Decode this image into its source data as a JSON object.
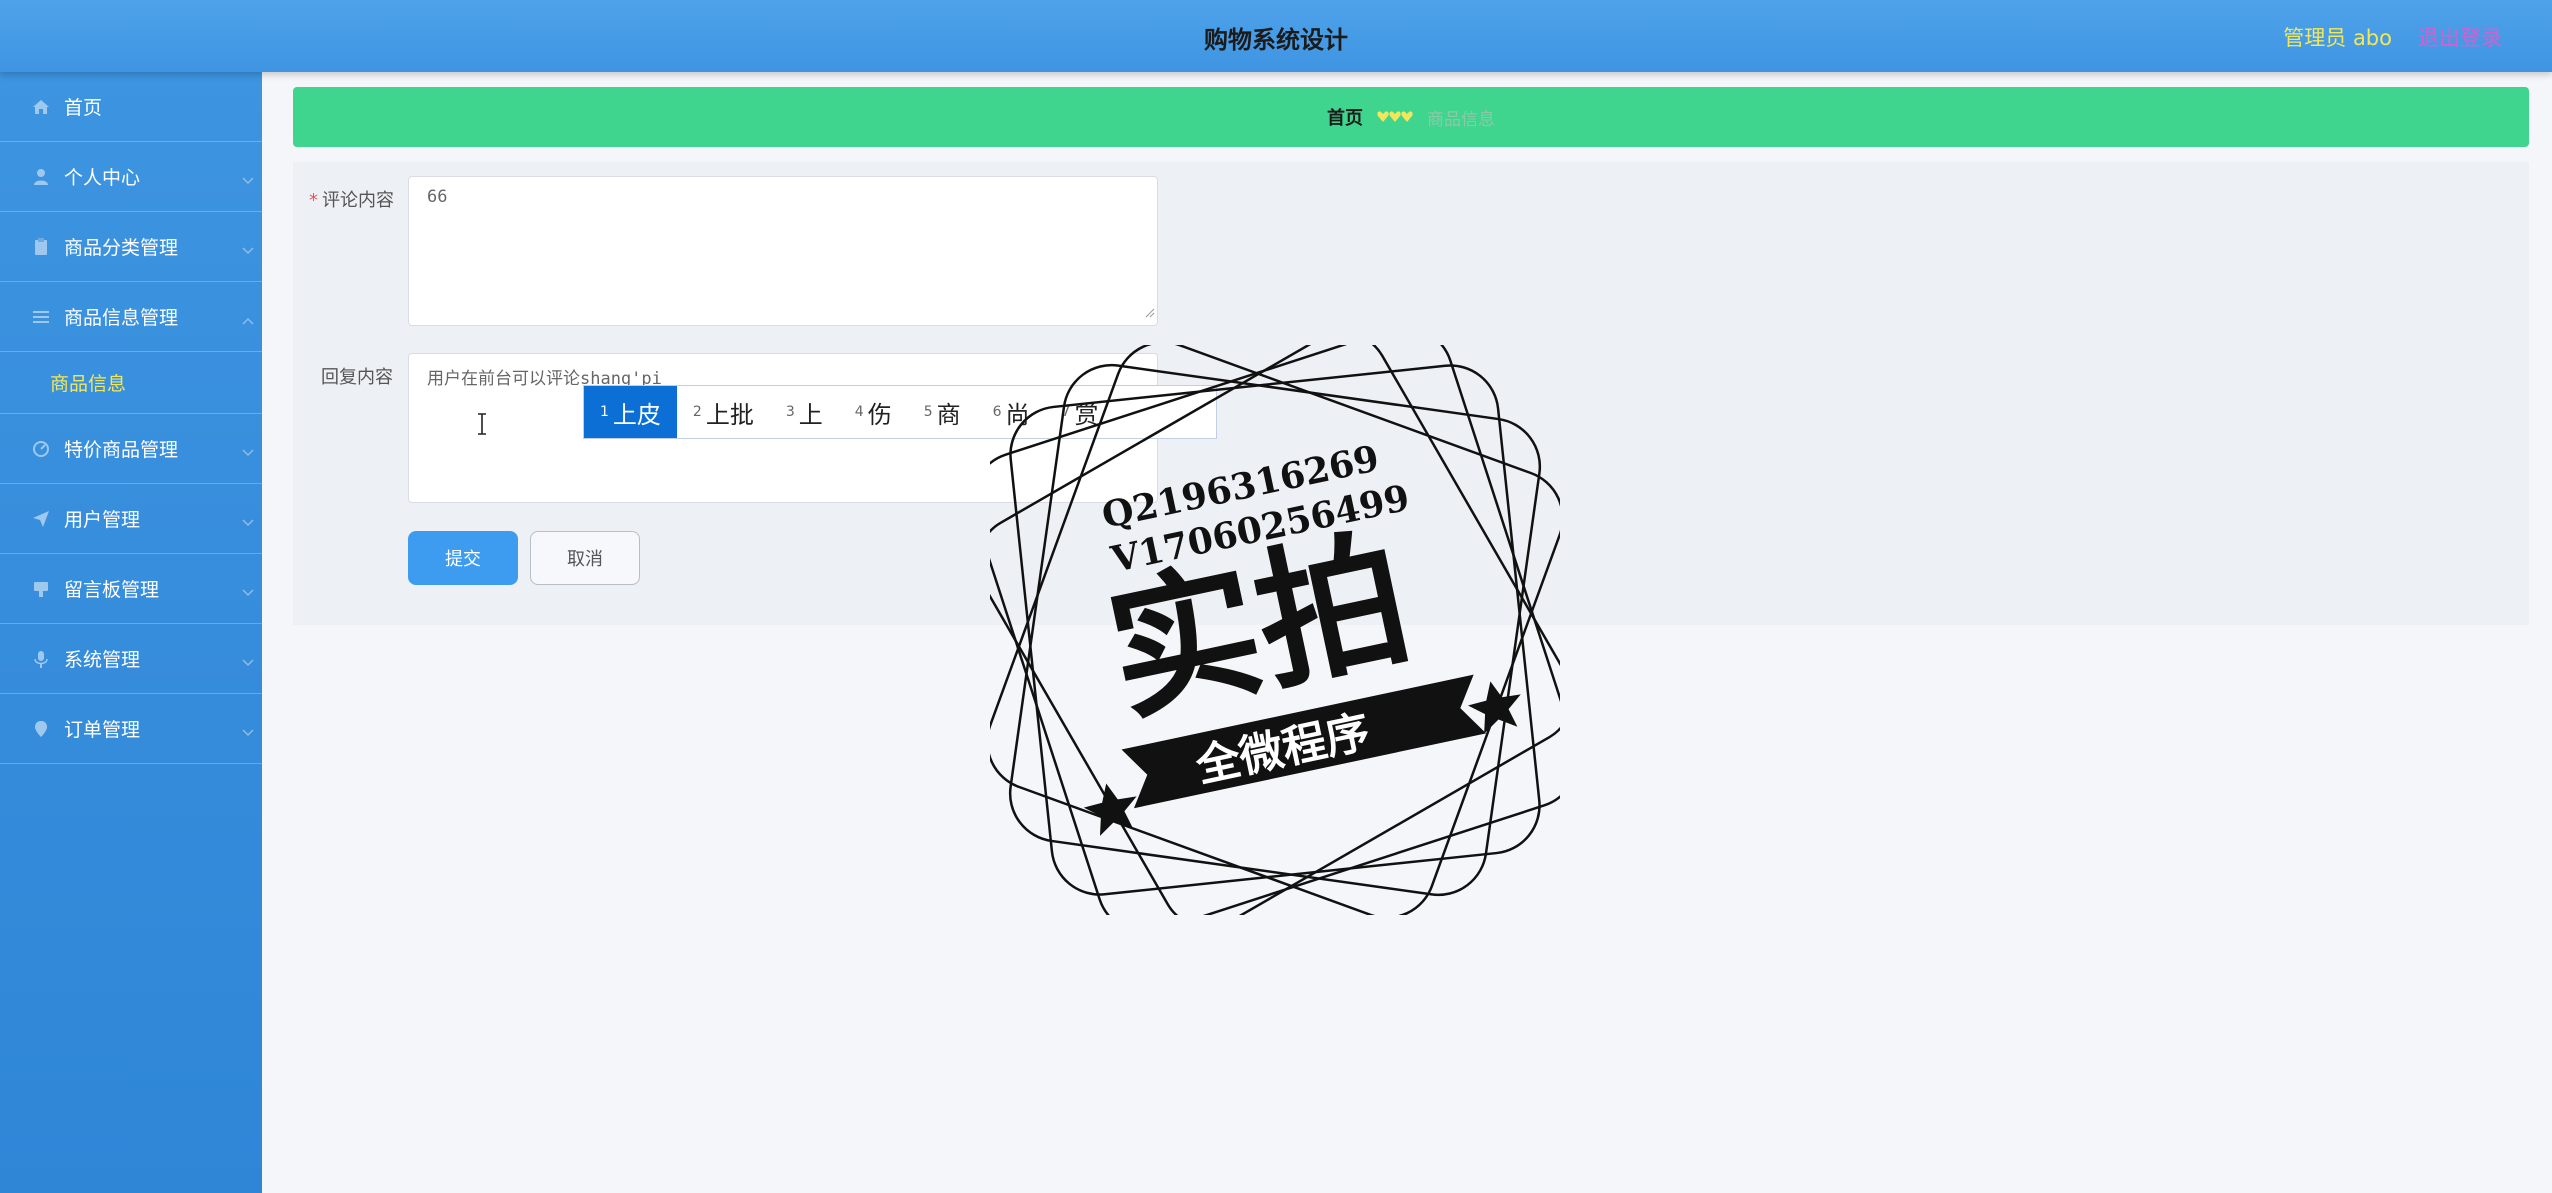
{
  "header": {
    "title": "购物系统设计",
    "user": "管理员 abo",
    "logout": "退出登录"
  },
  "sidebar": {
    "items": [
      {
        "label": "首页",
        "icon": "home-icon",
        "chevron": false
      },
      {
        "label": "个人中心",
        "icon": "user-icon",
        "chevron": true
      },
      {
        "label": "商品分类管理",
        "icon": "category-icon",
        "chevron": true
      },
      {
        "label": "商品信息管理",
        "icon": "list-icon",
        "chevron": true,
        "expanded": true,
        "children": [
          {
            "label": "商品信息"
          }
        ]
      },
      {
        "label": "特价商品管理",
        "icon": "dashboard-icon",
        "chevron": true
      },
      {
        "label": "用户管理",
        "icon": "send-icon",
        "chevron": true
      },
      {
        "label": "留言板管理",
        "icon": "message-board-icon",
        "chevron": true
      },
      {
        "label": "系统管理",
        "icon": "microphone-icon",
        "chevron": true
      },
      {
        "label": "订单管理",
        "icon": "location-icon",
        "chevron": true
      }
    ]
  },
  "breadcrumb": {
    "home": "首页",
    "current": "商品信息"
  },
  "form": {
    "comment_label": "评论内容",
    "comment_value": "66",
    "reply_label": "回复内容",
    "reply_value": "用户在前台可以评论shang'pi",
    "submit": "提交",
    "cancel": "取消"
  },
  "ime": {
    "candidates": [
      {
        "num": "1",
        "text": "上皮"
      },
      {
        "num": "2",
        "text": "上批"
      },
      {
        "num": "3",
        "text": "上"
      },
      {
        "num": "4",
        "text": "伤"
      },
      {
        "num": "5",
        "text": "商"
      },
      {
        "num": "6",
        "text": "尚"
      },
      {
        "num": "7",
        "text": "赏"
      }
    ],
    "selected_index": 0
  },
  "watermark": {
    "line1": "Q2196316269",
    "line2": "V17060256499",
    "main": "实拍",
    "banner": "全微程序"
  },
  "colors": {
    "header": "#449ce6",
    "sidebar": "#3590dc",
    "breadcrumb": "#3fd58f",
    "accent_yellow": "#f2e75a",
    "logout": "#d55fd0",
    "primary_button": "#3e9cf0",
    "ime_selected": "#0b6fd6"
  }
}
